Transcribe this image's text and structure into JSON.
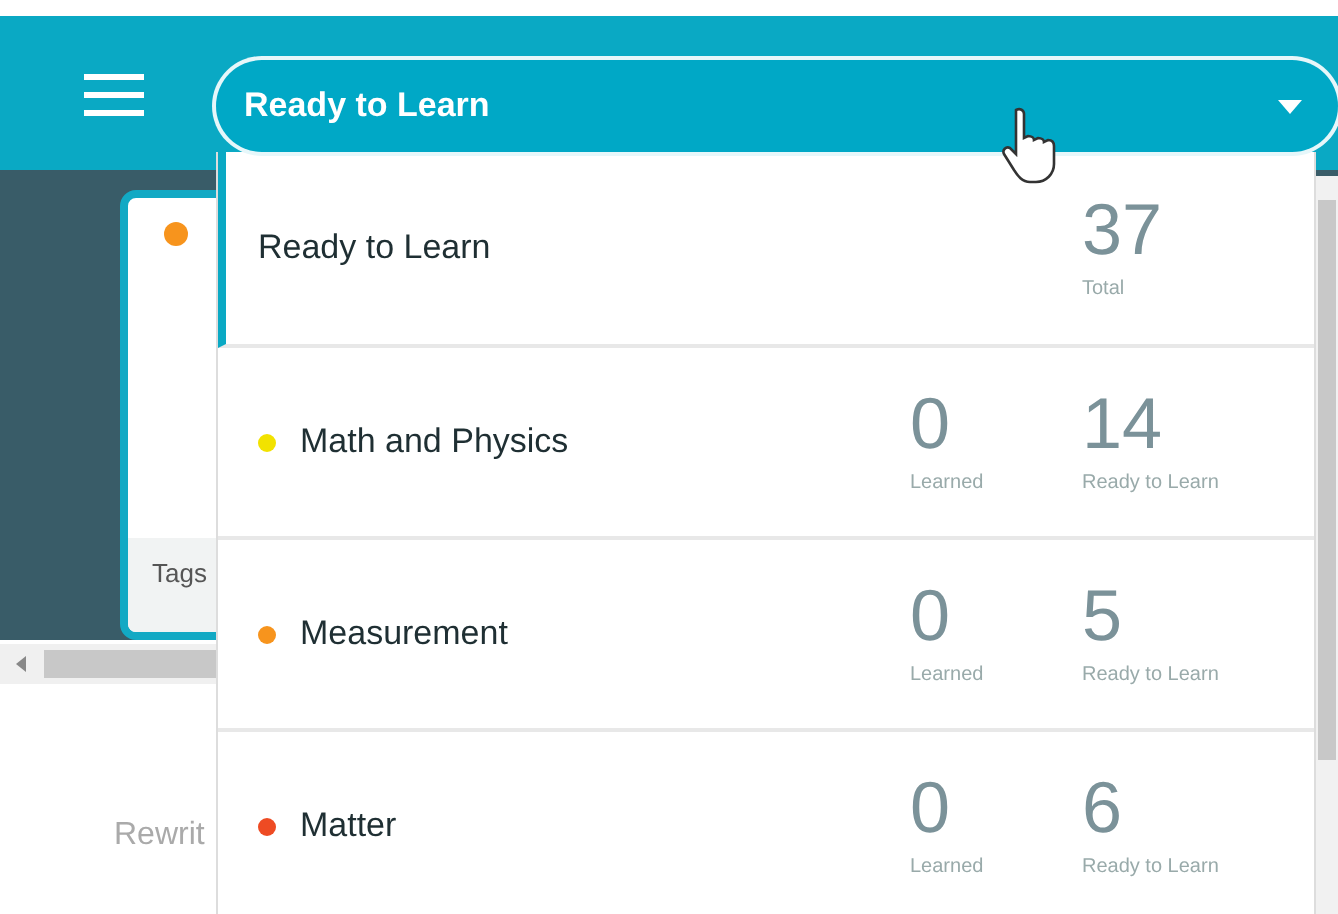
{
  "dropdown": {
    "value": "Ready to Learn",
    "expanded": true
  },
  "card": {
    "color": "#f7941d",
    "footer": "Tags"
  },
  "hint_text": "Rewrit",
  "menu": {
    "items": [
      {
        "kind": "total",
        "label": "Ready to Learn",
        "selected": true,
        "stats": [
          {
            "value": "37",
            "label": "Total"
          }
        ]
      },
      {
        "kind": "category",
        "label": "Math and Physics",
        "color": "#f2e200",
        "selected": false,
        "stats": [
          {
            "value": "0",
            "label": "Learned"
          },
          {
            "value": "14",
            "label": "Ready to Learn"
          }
        ]
      },
      {
        "kind": "category",
        "label": "Measurement",
        "color": "#f7941d",
        "selected": false,
        "stats": [
          {
            "value": "0",
            "label": "Learned"
          },
          {
            "value": "5",
            "label": "Ready to Learn"
          }
        ]
      },
      {
        "kind": "category",
        "label": "Matter",
        "color": "#ee4b23",
        "selected": false,
        "stats": [
          {
            "value": "0",
            "label": "Learned"
          },
          {
            "value": "6",
            "label": "Ready to Learn"
          }
        ]
      }
    ]
  }
}
